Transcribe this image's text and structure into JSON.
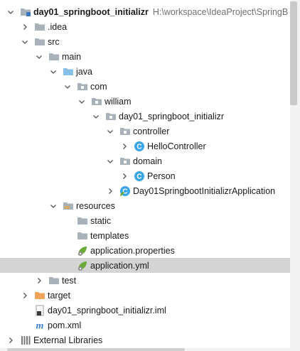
{
  "tree": {
    "items": [
      {
        "label": "day01_springboot_initializr",
        "path": "H:\\workspace\\IdeaProject\\SpringB",
        "icon": "module-folder-icon",
        "arrow": "down",
        "indent": 0,
        "bold": true
      },
      {
        "label": ".idea",
        "icon": "folder-icon",
        "arrow": "right",
        "indent": 1
      },
      {
        "label": "src",
        "icon": "folder-icon",
        "arrow": "down",
        "indent": 1
      },
      {
        "label": "main",
        "icon": "folder-icon",
        "arrow": "down",
        "indent": 2
      },
      {
        "label": "java",
        "icon": "source-folder-icon",
        "arrow": "down",
        "indent": 3
      },
      {
        "label": "com",
        "icon": "package-icon",
        "arrow": "down",
        "indent": 4
      },
      {
        "label": "william",
        "icon": "package-icon",
        "arrow": "down",
        "indent": 5
      },
      {
        "label": "day01_springboot_initializr",
        "icon": "package-icon",
        "arrow": "down",
        "indent": 6
      },
      {
        "label": "controller",
        "icon": "package-icon",
        "arrow": "down",
        "indent": 7
      },
      {
        "label": "HelloController",
        "icon": "class-icon",
        "arrow": "right",
        "indent": 8
      },
      {
        "label": "domain",
        "icon": "package-icon",
        "arrow": "down",
        "indent": 7
      },
      {
        "label": "Person",
        "icon": "class-icon",
        "arrow": "right",
        "indent": 8
      },
      {
        "label": "Day01SpringbootInitializrApplication",
        "icon": "spring-app-class-icon",
        "arrow": "right",
        "indent": 7
      },
      {
        "label": "resources",
        "icon": "resources-folder-icon",
        "arrow": "down",
        "indent": 3
      },
      {
        "label": "static",
        "icon": "folder-icon",
        "arrow": "none",
        "indent": 4
      },
      {
        "label": "templates",
        "icon": "folder-icon",
        "arrow": "none",
        "indent": 4
      },
      {
        "label": "application.properties",
        "icon": "spring-properties-icon",
        "arrow": "none",
        "indent": 4
      },
      {
        "label": "application.yml",
        "icon": "spring-properties-icon",
        "arrow": "none",
        "indent": 4,
        "selected": true
      },
      {
        "label": "test",
        "icon": "folder-icon",
        "arrow": "right",
        "indent": 2
      },
      {
        "label": "target",
        "icon": "excluded-folder-icon",
        "arrow": "right",
        "indent": 1
      },
      {
        "label": "day01_springboot_initializr.iml",
        "icon": "iml-file-icon",
        "arrow": "none",
        "indent": 1
      },
      {
        "label": "pom.xml",
        "icon": "maven-icon",
        "arrow": "none",
        "indent": 1
      },
      {
        "label": "External Libraries",
        "icon": "libraries-icon",
        "arrow": "right",
        "indent": 0
      }
    ]
  },
  "colors": {
    "folder": "#a9b2ba",
    "source_folder": "#87bfe8",
    "resources_folder": "#a9b2ba",
    "excluded_folder": "#f0a35b",
    "class_circle": "#3aa6e6",
    "spring_leaf": "#6aab3a",
    "maven": "#3c7cc8",
    "selection": "#d4d4d4"
  }
}
